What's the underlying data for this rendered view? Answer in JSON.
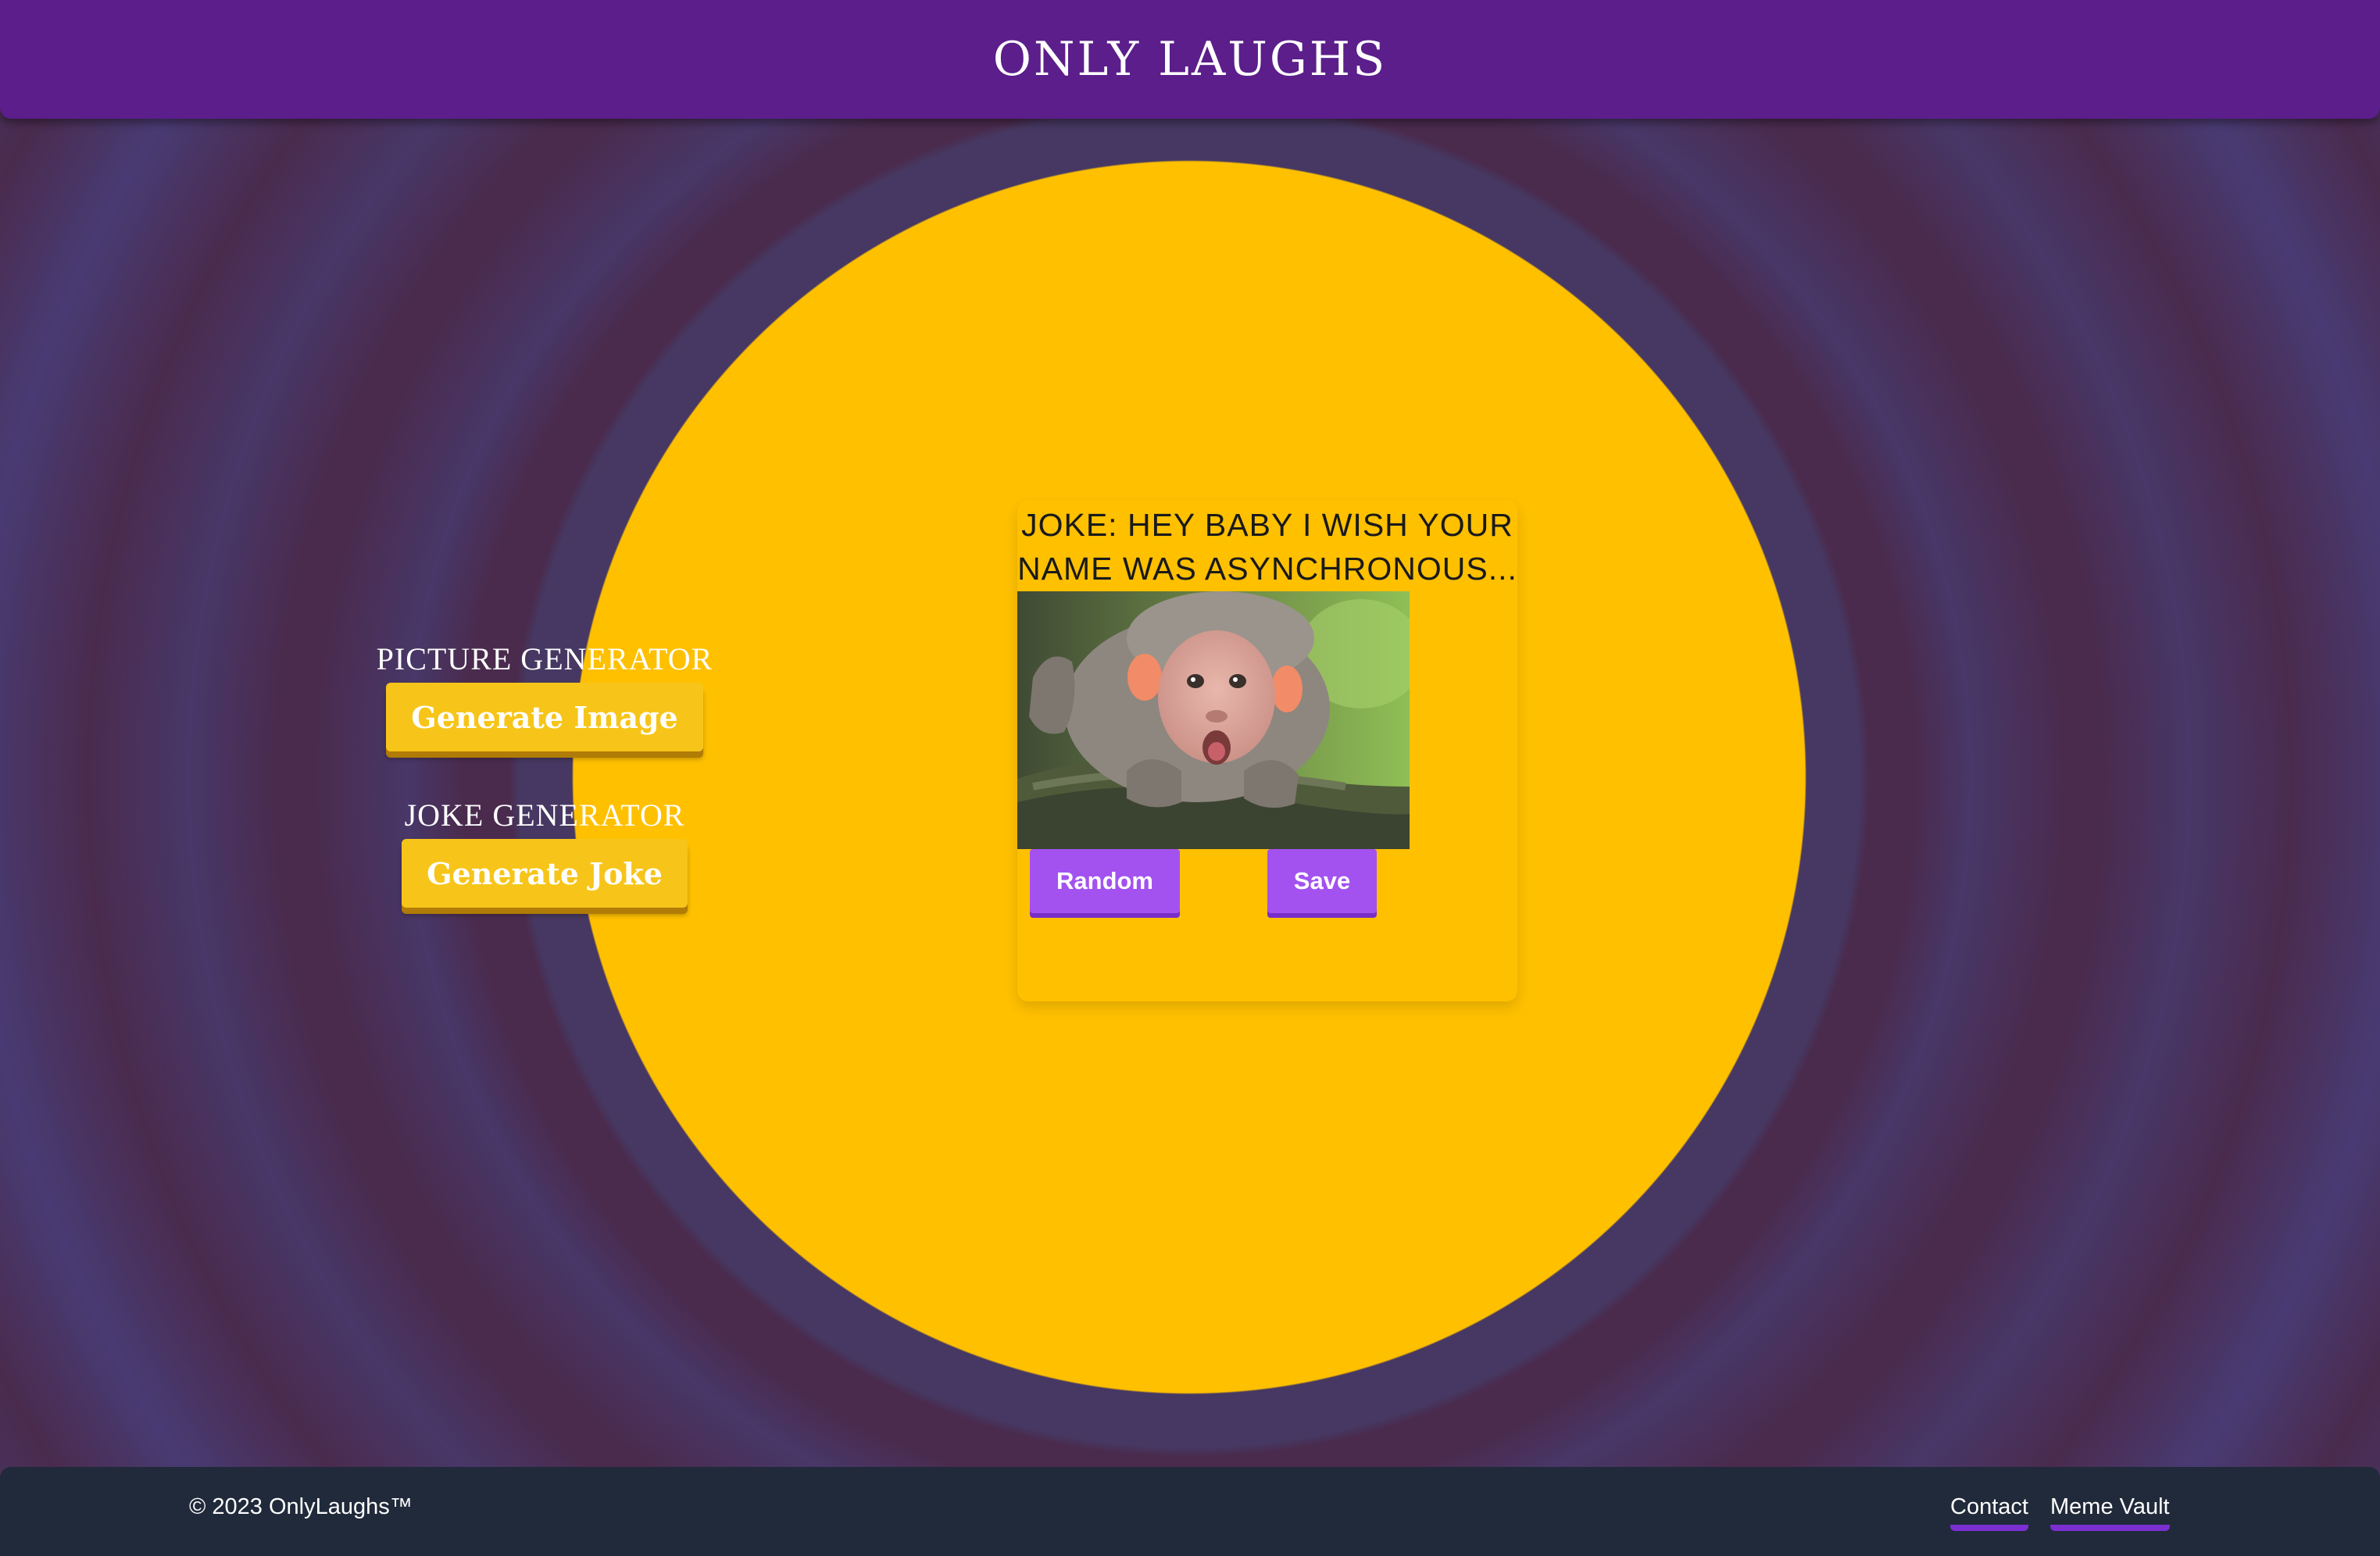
{
  "header": {
    "title": "ONLY LAUGHS"
  },
  "picture_generator": {
    "label": "PICTURE GENERATOR",
    "button": "Generate Image"
  },
  "joke_generator": {
    "label": "JOKE GENERATOR",
    "button": "Generate Joke"
  },
  "meme_card": {
    "joke": "JOKE: HEY BABY I WISH YOUR NAME WAS ASYNCHRONOUS...",
    "image_subject": "baby-macaque-monkey",
    "random_button": "Random",
    "save_button": "Save"
  },
  "footer": {
    "copyright": "© 2023 OnlyLaughs™",
    "links": [
      {
        "label": "Contact"
      },
      {
        "label": "Meme Vault"
      }
    ]
  },
  "colors": {
    "header": "#5b1e8a",
    "sun": "#ffc000",
    "generator_button": "#f7c519",
    "card_button": "#a352f0",
    "footer": "#202a3a",
    "link_underline": "#7b2fd1"
  }
}
